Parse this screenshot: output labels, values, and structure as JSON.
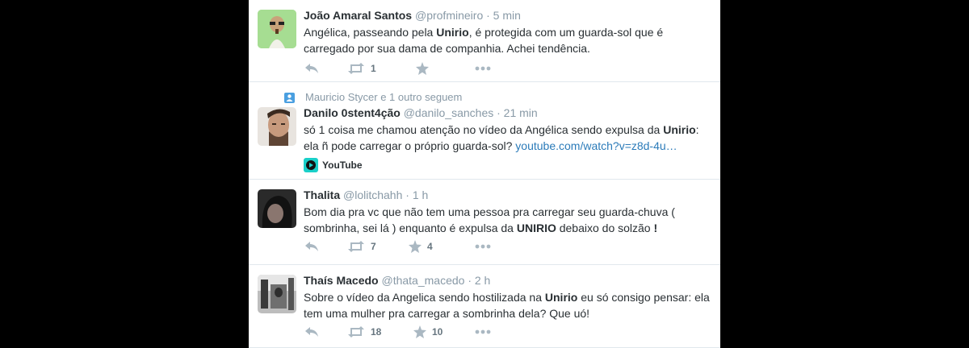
{
  "tweets": [
    {
      "name": "João Amaral Santos",
      "handle": "@profmineiro",
      "time": "· 5 min",
      "text_parts": [
        "Angélica, passeando pela ",
        "Unirio",
        ", é protegida com um guarda-sol que é carregado por sua dama de companhia. Achei tendência."
      ],
      "retweets": "1",
      "favorites": ""
    },
    {
      "context": "Mauricio Stycer e 1 outro seguem",
      "name": "Danilo 0stent4ção",
      "handle": "@danilo_sanches",
      "time": "· 21 min",
      "text_parts": [
        "só 1 coisa me chamou atenção no vídeo da Angélica sendo expulsa da ",
        "Unirio",
        ": ela ñ pode carregar o próprio guarda-sol? "
      ],
      "link": "youtube.com/watch?v=z8d-4u…",
      "card_label": "YouTube"
    },
    {
      "name": "Thalita",
      "handle": "@lolitchahh",
      "time": "· 1 h",
      "text_parts": [
        "Bom dia pra vc que não tem uma pessoa pra carregar seu guarda-chuva ( sombrinha, sei lá ) enquanto é expulsa da ",
        "UNIRIO",
        " debaixo do solzão ",
        "!"
      ],
      "retweets": "7",
      "favorites": "4"
    },
    {
      "name": "Thaís Macedo",
      "handle": "@thata_macedo",
      "time": "· 2 h",
      "text_parts": [
        "Sobre o vídeo da Angelica sendo hostilizada na ",
        "Unirio",
        " eu só consigo pensar: ela tem uma mulher pra carregar a sombrinha dela? Que uó!"
      ],
      "retweets": "18",
      "favorites": "10"
    }
  ],
  "colors": {
    "background": "#000000",
    "timeline": "#ffffff",
    "muted": "#8899a6",
    "link": "#2b7bb9",
    "youtube_badge": "#1ad0c9"
  },
  "icons": [
    "reply-icon",
    "retweet-icon",
    "favorite-icon",
    "more-icon",
    "follow-context-icon",
    "youtube-icon"
  ]
}
